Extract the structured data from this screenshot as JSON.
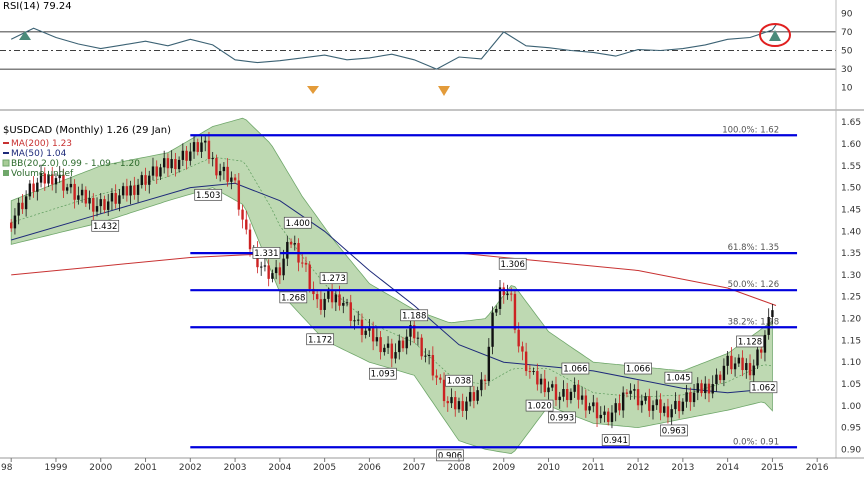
{
  "colors": {
    "fib": "#0000dd",
    "rsi": "#3c6274",
    "ma200": "#c83232",
    "ma50": "#1e2a7a",
    "bb_fill": "#a8cc98",
    "bb_line": "#6fa76a",
    "up": "#111111",
    "down": "#cc2222",
    "circle": "#e02020"
  },
  "rsi_panel": {
    "title": "RSI(14) 79.24",
    "ticks": [
      "90",
      "70",
      "50",
      "30",
      "10"
    ],
    "ylim": [
      0,
      100
    ],
    "levels": [
      70,
      50,
      30
    ]
  },
  "price_panel": {
    "title": "$USDCAD (Monthly) 1.26 (29 Jan)",
    "ma200": "MA(200) 1.23",
    "ma50": "MA(50) 1.04",
    "bb": "BB(20,2.0) 0.99 - 1.09 - 1.20",
    "volume": "Volume undef",
    "ticks": [
      "1.65",
      "1.60",
      "1.55",
      "1.50",
      "1.45",
      "1.40",
      "1.35",
      "1.30",
      "1.25",
      "1.20",
      "1.15",
      "1.10",
      "1.05",
      "1.00",
      "0.95",
      "0.90"
    ]
  },
  "x_axis": {
    "labels": [
      "98",
      "1999",
      "2000",
      "2001",
      "2002",
      "2003",
      "2004",
      "2005",
      "2006",
      "2007",
      "2008",
      "2009",
      "2010",
      "2011",
      "2012",
      "2013",
      "2014",
      "2015",
      "2016"
    ]
  },
  "chart_data": [
    {
      "type": "line",
      "title": "RSI(14) 79.24",
      "x": [
        1998.0,
        1998.5,
        1999.0,
        1999.5,
        2000.0,
        2000.5,
        2001.0,
        2001.5,
        2002.0,
        2002.5,
        2003.0,
        2003.5,
        2004.0,
        2004.5,
        2005.0,
        2005.5,
        2006.0,
        2006.5,
        2007.0,
        2007.5,
        2008.0,
        2008.5,
        2009.0,
        2009.5,
        2010.0,
        2010.5,
        2011.0,
        2011.5,
        2012.0,
        2012.5,
        2013.0,
        2013.5,
        2014.0,
        2014.5,
        2015.0,
        2015.1
      ],
      "values": [
        62,
        74,
        64,
        57,
        52,
        56,
        60,
        55,
        62,
        56,
        40,
        37,
        39,
        42,
        45,
        40,
        42,
        46,
        40,
        30,
        43,
        41,
        70,
        55,
        53,
        50,
        48,
        44,
        51,
        50,
        52,
        56,
        62,
        64,
        72,
        79
      ],
      "ylim": [
        0,
        100
      ]
    },
    {
      "type": "line",
      "title": "$USDCAD (Monthly) 1.26 (29 Jan)",
      "ylim": [
        0.885,
        1.655
      ],
      "series": [
        {
          "name": "USDCAD",
          "x": [
            1998.0,
            1998.5,
            1999.0,
            1999.5,
            2000.0,
            2000.5,
            2001.0,
            2001.5,
            2002.0,
            2002.3,
            2002.6,
            2003.0,
            2003.3,
            2003.7,
            2004.0,
            2004.3,
            2004.6,
            2004.9,
            2005.0,
            2005.4,
            2005.8,
            2006.2,
            2006.6,
            2007.0,
            2007.4,
            2007.8,
            2008.0,
            2008.3,
            2008.6,
            2008.8,
            2009.0,
            2009.2,
            2009.4,
            2009.7,
            2010.0,
            2010.3,
            2010.6,
            2011.0,
            2011.3,
            2011.6,
            2011.8,
            2012.0,
            2012.3,
            2012.6,
            2012.9,
            2013.2,
            2013.5,
            2013.8,
            2014.0,
            2014.3,
            2014.6,
            2014.8,
            2015.0,
            2015.08
          ],
          "values": [
            1.42,
            1.5,
            1.53,
            1.48,
            1.46,
            1.48,
            1.52,
            1.55,
            1.58,
            1.6,
            1.55,
            1.52,
            1.38,
            1.31,
            1.3,
            1.38,
            1.32,
            1.22,
            1.24,
            1.25,
            1.18,
            1.15,
            1.12,
            1.17,
            1.1,
            1.0,
            1.0,
            1.02,
            1.05,
            1.2,
            1.28,
            1.25,
            1.12,
            1.06,
            1.05,
            1.02,
            1.03,
            1.0,
            0.97,
            0.99,
            1.05,
            1.02,
            1.0,
            0.99,
            1.0,
            1.02,
            1.04,
            1.06,
            1.1,
            1.09,
            1.09,
            1.14,
            1.2,
            1.26
          ]
        },
        {
          "name": "MA(200) 1.23",
          "x": [
            1998.0,
            2000.0,
            2002.0,
            2004.0,
            2006.0,
            2008.0,
            2010.0,
            2012.0,
            2014.0,
            2015.08
          ],
          "values": [
            1.3,
            1.32,
            1.34,
            1.35,
            1.35,
            1.35,
            1.33,
            1.31,
            1.27,
            1.23
          ]
        },
        {
          "name": "MA(50) 1.04",
          "x": [
            1998.0,
            2000.0,
            2002.0,
            2003.0,
            2004.0,
            2005.0,
            2006.0,
            2007.0,
            2008.0,
            2009.0,
            2010.0,
            2011.0,
            2012.0,
            2013.0,
            2014.0,
            2015.08
          ],
          "values": [
            1.38,
            1.44,
            1.5,
            1.51,
            1.47,
            1.4,
            1.31,
            1.23,
            1.14,
            1.1,
            1.09,
            1.08,
            1.06,
            1.04,
            1.03,
            1.04
          ]
        },
        {
          "name": "BB upper",
          "x": [
            1998.0,
            2000.0,
            2001.5,
            2002.5,
            2003.2,
            2003.8,
            2004.5,
            2005.2,
            2006.0,
            2007.0,
            2007.8,
            2008.6,
            2009.2,
            2010.0,
            2011.0,
            2012.0,
            2013.0,
            2014.0,
            2015.08
          ],
          "values": [
            1.47,
            1.55,
            1.58,
            1.64,
            1.66,
            1.6,
            1.48,
            1.38,
            1.28,
            1.22,
            1.19,
            1.2,
            1.28,
            1.17,
            1.1,
            1.09,
            1.08,
            1.12,
            1.2
          ]
        },
        {
          "name": "BB lower",
          "x": [
            1998.0,
            2000.0,
            2001.5,
            2002.5,
            2003.2,
            2004.0,
            2005.0,
            2006.0,
            2007.0,
            2008.0,
            2008.6,
            2009.2,
            2010.0,
            2011.0,
            2012.0,
            2013.0,
            2014.0,
            2014.8,
            2015.08
          ],
          "values": [
            1.37,
            1.42,
            1.47,
            1.5,
            1.46,
            1.26,
            1.15,
            1.1,
            1.07,
            0.92,
            0.9,
            0.89,
            1.0,
            0.96,
            0.95,
            0.97,
            0.99,
            1.01,
            0.98
          ]
        }
      ],
      "fib_levels": [
        {
          "label": "100.0%: 1.62",
          "value": 1.62
        },
        {
          "label": "61.8%: 1.35",
          "value": 1.35
        },
        {
          "label": "50.0%: 1.26",
          "value": 1.265
        },
        {
          "label": "38.2%: 1.18",
          "value": 1.18
        },
        {
          "label": "0.0%: 0.91",
          "value": 0.905
        }
      ],
      "annotations": [
        {
          "label": "1.432",
          "x": 2000.1,
          "y": 1.432
        },
        {
          "label": "1.503",
          "x": 2002.4,
          "y": 1.503
        },
        {
          "label": "1.400",
          "x": 2004.4,
          "y": 1.4
        },
        {
          "label": "1.331",
          "x": 2003.7,
          "y": 1.331
        },
        {
          "label": "1.268",
          "x": 2004.3,
          "y": 1.268
        },
        {
          "label": "1.273",
          "x": 2005.2,
          "y": 1.273
        },
        {
          "label": "1.172",
          "x": 2004.9,
          "y": 1.172
        },
        {
          "label": "1.188",
          "x": 2007.0,
          "y": 1.188
        },
        {
          "label": "1.093",
          "x": 2006.3,
          "y": 1.093
        },
        {
          "label": "1.038",
          "x": 2008.0,
          "y": 1.038
        },
        {
          "label": "0.906",
          "x": 2007.8,
          "y": 0.906
        },
        {
          "label": "1.306",
          "x": 2009.2,
          "y": 1.306
        },
        {
          "label": "1.020",
          "x": 2009.8,
          "y": 1.02
        },
        {
          "label": "0.993",
          "x": 2010.3,
          "y": 0.993
        },
        {
          "label": "1.066",
          "x": 2010.6,
          "y": 1.066
        },
        {
          "label": "0.941",
          "x": 2011.5,
          "y": 0.941
        },
        {
          "label": "1.066",
          "x": 2012.0,
          "y": 1.066
        },
        {
          "label": "1.045",
          "x": 2012.9,
          "y": 1.045
        },
        {
          "label": "0.963",
          "x": 2012.8,
          "y": 0.963
        },
        {
          "label": "1.128",
          "x": 2014.5,
          "y": 1.128
        },
        {
          "label": "1.062",
          "x": 2014.8,
          "y": 1.062
        }
      ]
    }
  ]
}
